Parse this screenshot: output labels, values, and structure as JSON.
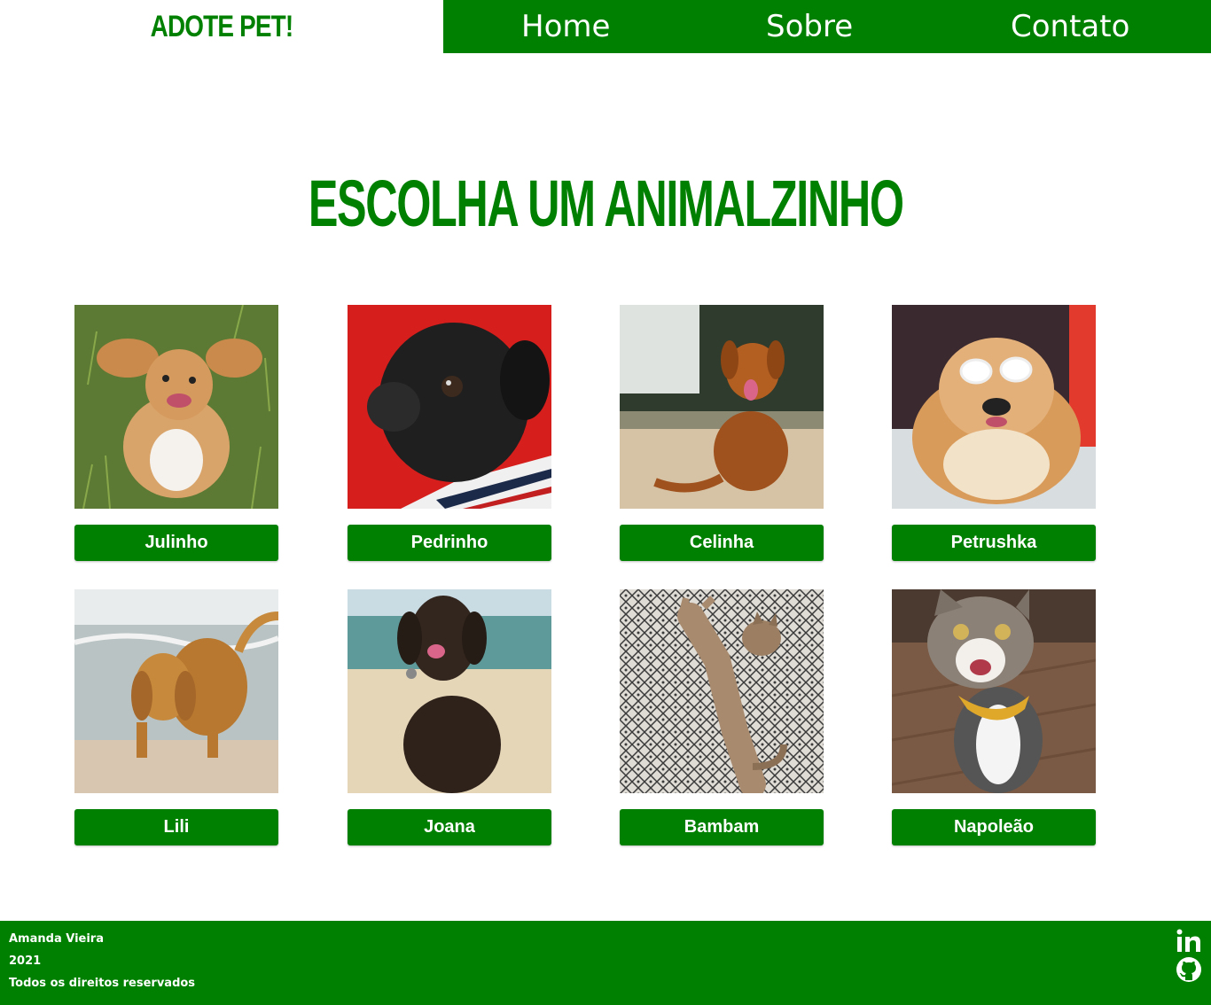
{
  "header": {
    "brand": "ADOTE PET!",
    "nav": [
      {
        "label": "Home"
      },
      {
        "label": "Sobre"
      },
      {
        "label": "Contato"
      }
    ]
  },
  "main": {
    "title": "ESCOLHA UM ANIMALZINHO",
    "pets": [
      {
        "name": "Julinho"
      },
      {
        "name": "Pedrinho"
      },
      {
        "name": "Celinha"
      },
      {
        "name": "Petrushka"
      },
      {
        "name": "Lili"
      },
      {
        "name": "Joana"
      },
      {
        "name": "Bambam"
      },
      {
        "name": "Napoleão"
      }
    ]
  },
  "footer": {
    "author": "Amanda Vieira",
    "year": "2021",
    "rights": "Todos os direitos reservados",
    "social": [
      {
        "icon": "linkedin-icon"
      },
      {
        "icon": "github-icon"
      }
    ]
  },
  "colors": {
    "brand": "#008000",
    "background": "#ffffff"
  }
}
